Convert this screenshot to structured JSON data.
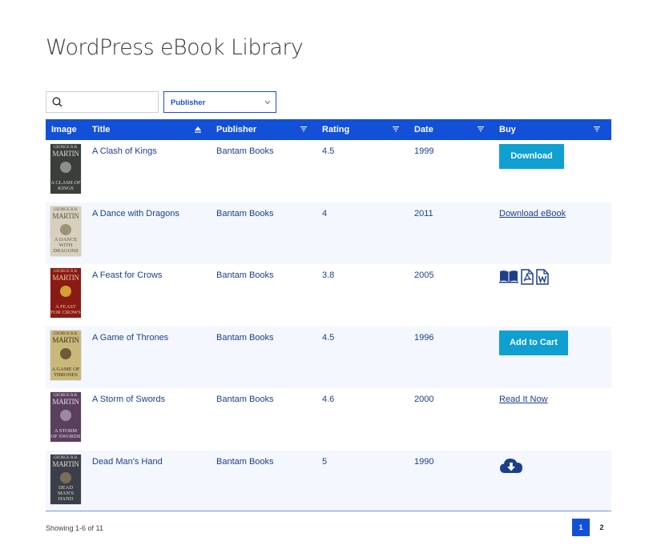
{
  "page": {
    "title": "WordPress eBook Library"
  },
  "search": {
    "placeholder": "",
    "value": ""
  },
  "filter": {
    "label": "Publisher"
  },
  "columns": {
    "image": "Image",
    "title": "Title",
    "publisher": "Publisher",
    "rating": "Rating",
    "date": "Date",
    "buy": "Buy"
  },
  "books": [
    {
      "title": "A Clash of Kings",
      "publisher": "Bantam Books",
      "rating": "4.5",
      "date": "1999",
      "buy": "Download",
      "cover_author_1": "GEORGE R.R.",
      "cover_author_2": "MARTIN",
      "cover_title": "A CLASH OF KINGS"
    },
    {
      "title": "A Dance with Dragons",
      "publisher": "Bantam Books",
      "rating": "4",
      "date": "2011",
      "buy": "Download eBook",
      "cover_author_1": "GEORGE R.R.",
      "cover_author_2": "MARTIN",
      "cover_title": "A DANCE WITH DRAGONS"
    },
    {
      "title": "A Feast for Crows",
      "publisher": "Bantam Books",
      "rating": "3.8",
      "date": "2005",
      "buy": "",
      "cover_author_1": "GEORGE R.R.",
      "cover_author_2": "MARTIN",
      "cover_title": "A FEAST FOR CROWS"
    },
    {
      "title": "A Game of Thrones",
      "publisher": "Bantam Books",
      "rating": "4.5",
      "date": "1996",
      "buy": "Add to Cart",
      "cover_author_1": "GEORGE R.R.",
      "cover_author_2": "MARTIN",
      "cover_title": "A GAME OF THRONES"
    },
    {
      "title": "A Storm of Swords",
      "publisher": "Bantam Books",
      "rating": "4.6",
      "date": "2000",
      "buy": "Read It Now",
      "cover_author_1": "GEORGE R.R.",
      "cover_author_2": "MARTIN",
      "cover_title": "A STORM OF SWORDS"
    },
    {
      "title": "Dead Man's Hand",
      "publisher": "Bantam Books",
      "rating": "5",
      "date": "1990",
      "buy": "",
      "cover_author_1": "GEORGE R.R.",
      "cover_author_2": "MARTIN",
      "cover_title": "DEAD MAN'S HAND"
    }
  ],
  "cover_colors": [
    "#3a3f3a",
    "#d8d0bc",
    "#8a1a14",
    "#c9b87a",
    "#5a3f5e",
    "#3a3f4a"
  ],
  "buy_icons": {
    "row3": [
      "book-open-icon",
      "pdf-file-icon",
      "word-file-icon"
    ],
    "row6": "cloud-download-icon"
  },
  "footer": {
    "showing": "Showing 1-6 of 11",
    "pages": [
      "1",
      "2"
    ],
    "current_page": "1"
  },
  "colors": {
    "header": "#1250d8",
    "button": "#0f9fd0",
    "text": "#1d3f8a"
  }
}
